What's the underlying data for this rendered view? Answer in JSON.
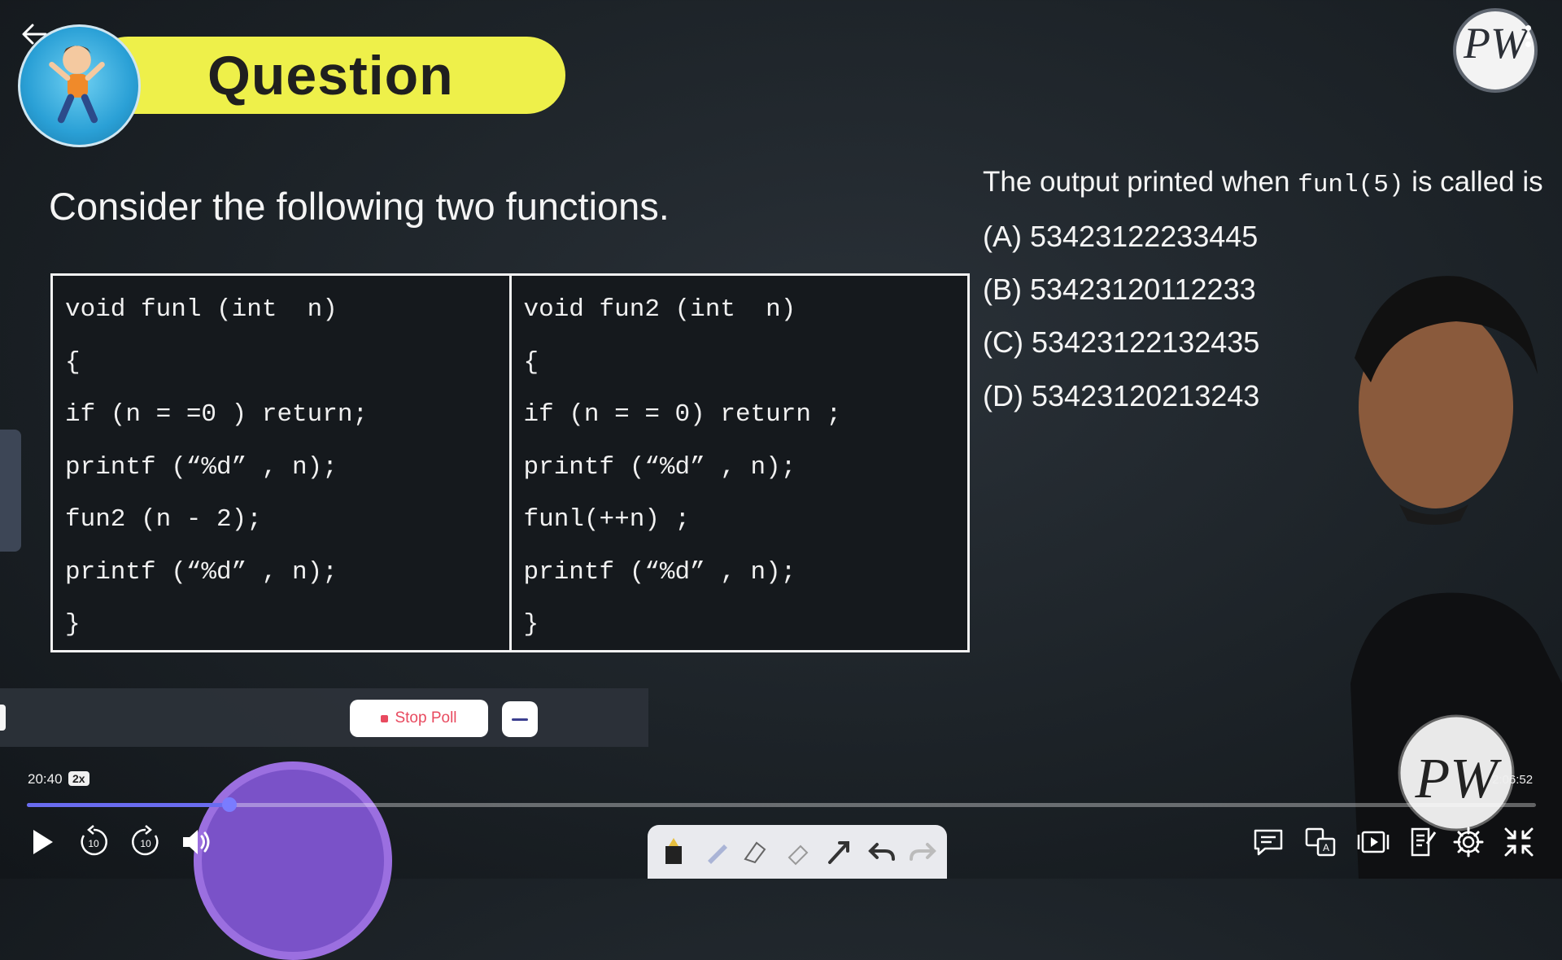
{
  "header": {
    "title": "Question",
    "back_icon": "arrow-left-icon",
    "logo_text": "PW",
    "more_icon": "more-vertical-icon"
  },
  "question": {
    "intro": "Consider the following two functions.",
    "fun1_lines": [
      "void funl (int  n)",
      "{",
      "if (n = =0 ) return;",
      "printf (“%d” , n);",
      "fun2 (n - 2);",
      "printf (“%d” , n);",
      "}"
    ],
    "fun2_lines": [
      "void fun2 (int  n)",
      "{",
      "if (n = = 0) return ;",
      "printf (“%d” , n);",
      "funl(++n) ;",
      "printf (“%d” , n);",
      "}"
    ],
    "prompt_before": "The output printed when ",
    "prompt_code": "funl(5)",
    "prompt_after": " is called is",
    "options": [
      "(A) 53423122233445",
      "(B) 53423120112233",
      "(C) 53423122132435",
      "(D) 53423120213243"
    ]
  },
  "poll": {
    "stop_label": "Stop Poll"
  },
  "player": {
    "current_time": "20:40",
    "speed": "2x",
    "total_time": "2:06:52",
    "progress_fraction": 0.134,
    "accent_color": "#6a6cf0",
    "rewind_label": "10",
    "forward_label": "10",
    "icons": [
      "play-icon",
      "rewind-10-icon",
      "forward-10-icon",
      "volume-icon",
      "chat-icon",
      "translate-icon",
      "playlist-icon",
      "notes-icon",
      "settings-icon",
      "exit-fullscreen-icon"
    ]
  },
  "draw_toolbar": {
    "tools": [
      "marker-icon",
      "pen-icon",
      "highlighter-icon",
      "eraser-icon",
      "pointer-icon",
      "undo-icon",
      "redo-icon"
    ]
  }
}
